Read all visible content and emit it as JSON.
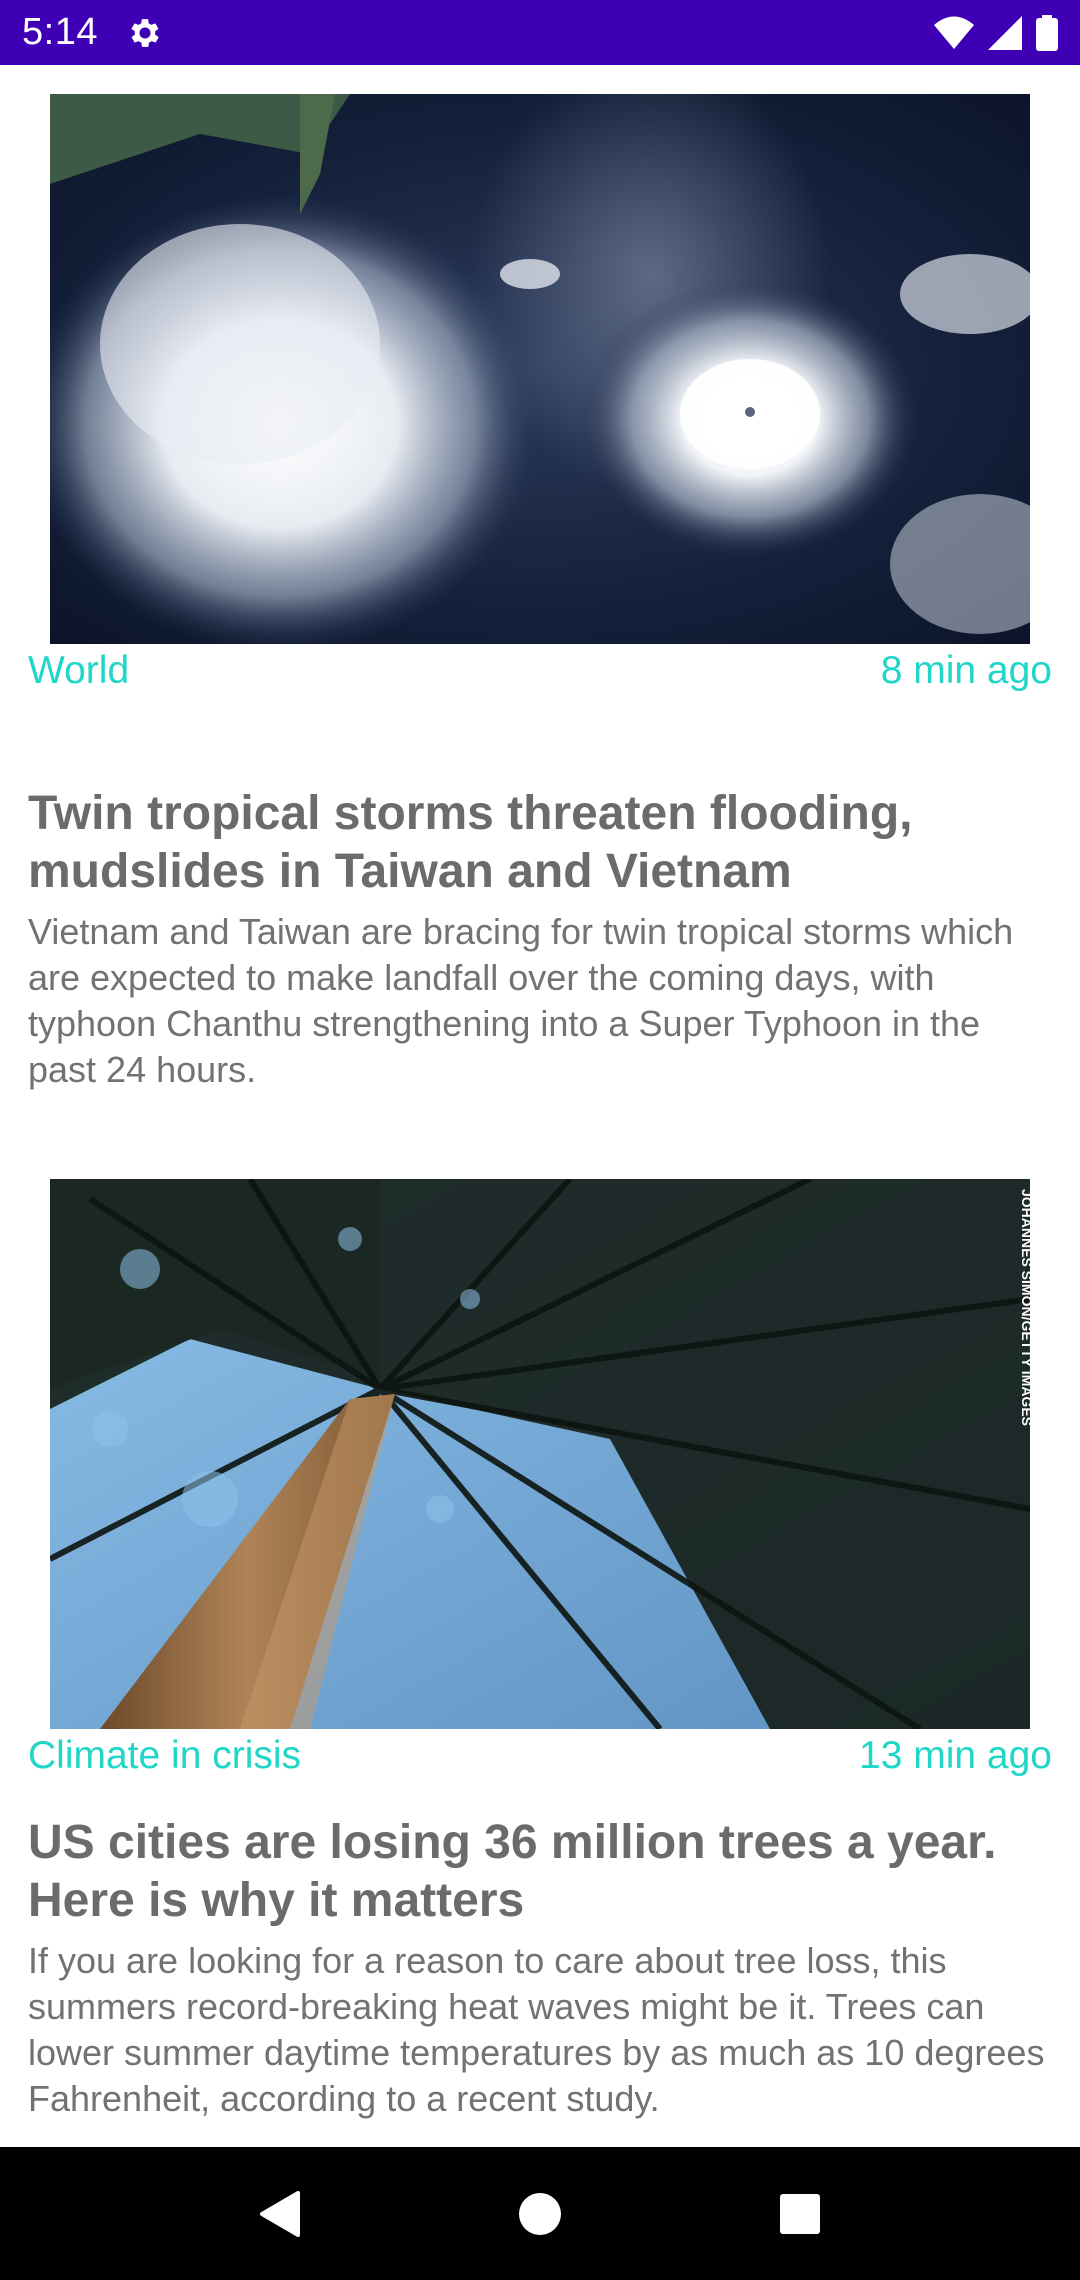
{
  "status_bar": {
    "time": "5:14",
    "icons": [
      "settings-gear-icon",
      "wifi-icon",
      "cell-signal-icon",
      "battery-icon"
    ]
  },
  "articles": [
    {
      "image": "satellite-typhoon-image",
      "category": "World",
      "time_ago": "8 min ago",
      "headline": "Twin tropical storms threaten flooding, mudslides in Taiwan and Vietnam",
      "summary": "Vietnam and Taiwan are bracing for twin tropical storms which are expected to make landfall over the coming days, with typhoon Chanthu strengthening into a Super Typhoon in the past 24 hours."
    },
    {
      "image": "forest-canopy-image",
      "image_credit": "JOHANNES SIMON/GETTY IMAGES",
      "category": "Climate in crisis",
      "time_ago": "13 min ago",
      "headline": "US cities are losing 36 million trees a year. Here is why it matters",
      "summary": "If you are looking for a reason to care about tree loss, this summers record-breaking heat waves might be it. Trees can lower summer daytime temperatures by as much as 10 degrees Fahrenheit, according to a recent study."
    }
  ],
  "nav_bar": {
    "buttons": [
      "back-icon",
      "home-icon",
      "recents-icon"
    ]
  },
  "colors": {
    "status_bar": "#3f00b5",
    "accent": "#1fd6c8",
    "headline": "#6b6b6b",
    "summary": "#727272",
    "nav_bar": "#000000"
  }
}
